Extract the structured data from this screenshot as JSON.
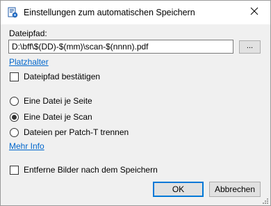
{
  "window": {
    "title": "Einstellungen zum automatischen Speichern"
  },
  "path": {
    "label": "Dateipfad:",
    "value": "D:\\bff\\$(DD)-$(mm)\\scan-$(nnnn).pdf",
    "browse_label": "...",
    "placeholder_link": "Platzhalter"
  },
  "confirm_checkbox": {
    "label": "Dateipfad bestätigen",
    "checked": false
  },
  "file_options": [
    {
      "label": "Eine Datei je Seite",
      "selected": false
    },
    {
      "label": "Eine Datei je Scan",
      "selected": true
    },
    {
      "label": "Dateien per Patch-T trennen",
      "selected": false
    }
  ],
  "more_info_link": "Mehr Info",
  "remove_images_checkbox": {
    "label": "Entferne Bilder nach dem Speichern",
    "checked": false
  },
  "buttons": {
    "ok": "OK",
    "cancel": "Abbrechen"
  },
  "icons": {
    "app": "document-gear-icon",
    "close": "close-icon"
  },
  "colors": {
    "accent": "#0078d7",
    "link": "#0066cc"
  }
}
